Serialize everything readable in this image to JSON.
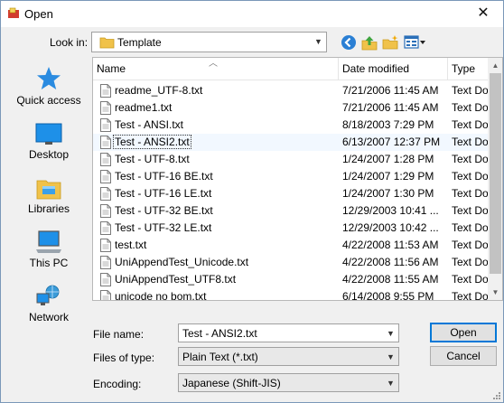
{
  "window": {
    "title": "Open",
    "close_glyph": "✕"
  },
  "toolbar": {
    "look_in_label": "Look in:",
    "look_in_value": "Template",
    "icons": [
      "back-icon",
      "up-folder-icon",
      "new-folder-icon",
      "view-menu-icon"
    ]
  },
  "places": [
    {
      "label": "Quick access",
      "icon": "star-icon"
    },
    {
      "label": "Desktop",
      "icon": "desktop-icon"
    },
    {
      "label": "Libraries",
      "icon": "libraries-icon"
    },
    {
      "label": "This PC",
      "icon": "computer-icon"
    },
    {
      "label": "Network",
      "icon": "network-icon"
    }
  ],
  "columns": {
    "name": "Name",
    "date": "Date modified",
    "type": "Type"
  },
  "files": [
    {
      "name": "readme_UTF-8.txt",
      "date": "7/21/2006 11:45 AM",
      "type": "Text Do"
    },
    {
      "name": "readme1.txt",
      "date": "7/21/2006 11:45 AM",
      "type": "Text Do"
    },
    {
      "name": "Test - ANSI.txt",
      "date": "8/18/2003 7:29 PM",
      "type": "Text Do"
    },
    {
      "name": "Test - ANSI2.txt",
      "date": "6/13/2007 12:37 PM",
      "type": "Text Do",
      "selected": true
    },
    {
      "name": "Test - UTF-8.txt",
      "date": "1/24/2007 1:28 PM",
      "type": "Text Do"
    },
    {
      "name": "Test - UTF-16 BE.txt",
      "date": "1/24/2007 1:29 PM",
      "type": "Text Do"
    },
    {
      "name": "Test - UTF-16 LE.txt",
      "date": "1/24/2007 1:30 PM",
      "type": "Text Do"
    },
    {
      "name": "Test - UTF-32 BE.txt",
      "date": "12/29/2003 10:41 ...",
      "type": "Text Do"
    },
    {
      "name": "Test - UTF-32 LE.txt",
      "date": "12/29/2003 10:42 ...",
      "type": "Text Do"
    },
    {
      "name": "test.txt",
      "date": "4/22/2008 11:53 AM",
      "type": "Text Do"
    },
    {
      "name": "UniAppendTest_Unicode.txt",
      "date": "4/22/2008 11:56 AM",
      "type": "Text Do"
    },
    {
      "name": "UniAppendTest_UTF8.txt",
      "date": "4/22/2008 11:55 AM",
      "type": "Text Do"
    },
    {
      "name": "unicode no bom.txt",
      "date": "6/14/2008 9:55 PM",
      "type": "Text Do"
    }
  ],
  "form": {
    "file_name_label": "File name:",
    "file_name_value": "Test - ANSI2.txt",
    "files_of_type_label": "Files of type:",
    "files_of_type_value": "Plain Text (*.txt)",
    "encoding_label": "Encoding:",
    "encoding_value": "Japanese (Shift-JIS)"
  },
  "buttons": {
    "open": "Open",
    "cancel": "Cancel"
  },
  "colors": {
    "accent": "#0078d7",
    "folder": "#f0c24a"
  }
}
